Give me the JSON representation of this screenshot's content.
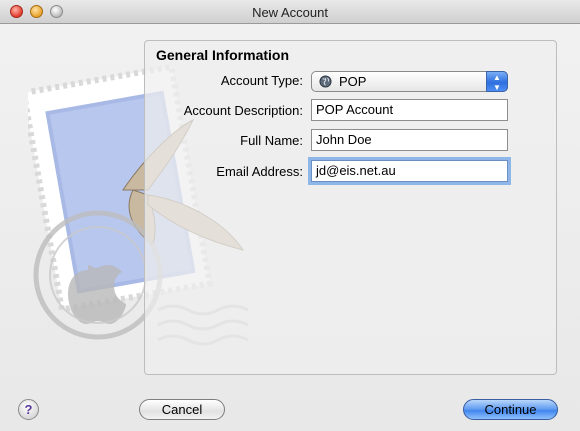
{
  "window": {
    "title": "New Account"
  },
  "section": {
    "title": "General Information"
  },
  "fields": {
    "account_type": {
      "label": "Account Type:",
      "value": "POP",
      "icon": "globe-icon"
    },
    "account_description": {
      "label": "Account Description:",
      "value": "POP Account"
    },
    "full_name": {
      "label": "Full Name:",
      "value": "John Doe"
    },
    "email_address": {
      "label": "Email Address:",
      "value": "jd@eis.net.au"
    }
  },
  "buttons": {
    "help": "?",
    "cancel": "Cancel",
    "continue": "Continue"
  },
  "colors": {
    "accent": "#3f85ee",
    "focus_ring": "#8eb6e8"
  }
}
